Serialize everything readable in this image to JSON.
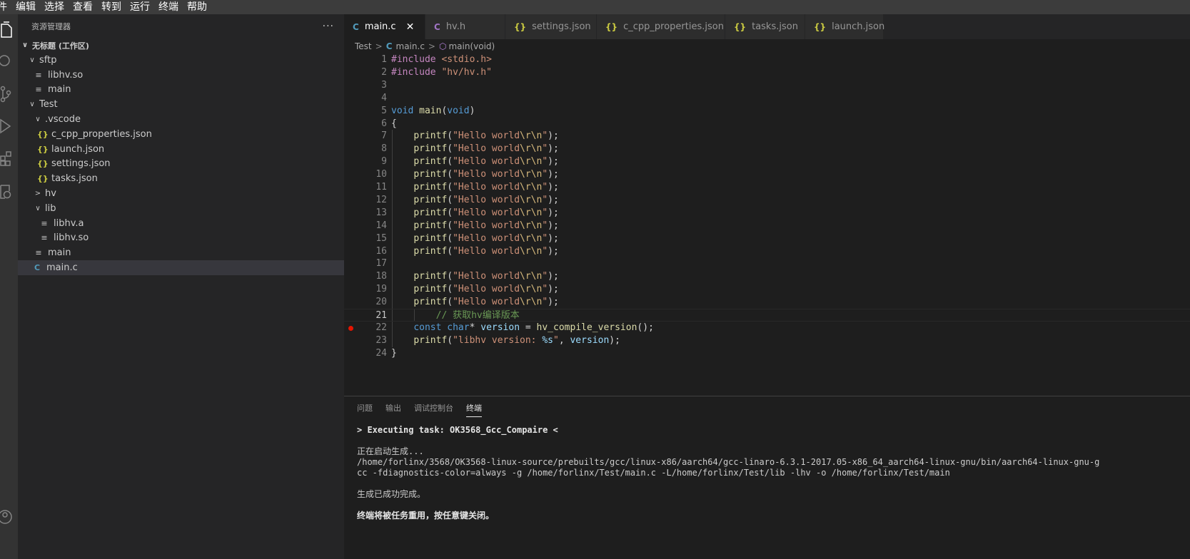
{
  "menu": [
    "件",
    "编辑",
    "选择",
    "查看",
    "转到",
    "运行",
    "终端",
    "帮助"
  ],
  "activity_icons": [
    "explorer-icon",
    "search-icon",
    "source-control-icon",
    "run-debug-icon",
    "extensions-icon",
    "remote-explorer-icon",
    "account-icon"
  ],
  "sidebar": {
    "title": "资源管理器",
    "more": "···",
    "tree": [
      {
        "label": "无标题 (工作区)",
        "chev": "∨",
        "icon": "",
        "type": "workspace"
      },
      {
        "label": "sftp",
        "chev": "∨",
        "icon": "",
        "type": "folder"
      },
      {
        "label": "libhv.so",
        "chev": "",
        "icon": "≡",
        "type": "txt"
      },
      {
        "label": "main",
        "chev": "",
        "icon": "≡",
        "type": "txt"
      },
      {
        "label": "Test",
        "chev": "∨",
        "icon": "",
        "type": "folder"
      },
      {
        "label": ".vscode",
        "chev": "∨",
        "icon": "",
        "type": "folder"
      },
      {
        "label": "c_cpp_properties.json",
        "chev": "",
        "icon": "{}",
        "type": "json"
      },
      {
        "label": "launch.json",
        "chev": "",
        "icon": "{}",
        "type": "json"
      },
      {
        "label": "settings.json",
        "chev": "",
        "icon": "{}",
        "type": "json"
      },
      {
        "label": "tasks.json",
        "chev": "",
        "icon": "{}",
        "type": "json"
      },
      {
        "label": "hv",
        "chev": ">",
        "icon": "",
        "type": "folder"
      },
      {
        "label": "lib",
        "chev": "∨",
        "icon": "",
        "type": "folder"
      },
      {
        "label": "libhv.a",
        "chev": "",
        "icon": "≡",
        "type": "txt"
      },
      {
        "label": "libhv.so",
        "chev": "",
        "icon": "≡",
        "type": "txt"
      },
      {
        "label": "main",
        "chev": "",
        "icon": "≡",
        "type": "txt"
      },
      {
        "label": "main.c",
        "chev": "",
        "icon": "C",
        "type": "c",
        "selected": true
      }
    ]
  },
  "tabs": [
    {
      "label": "main.c",
      "icon": "C",
      "kind": "c",
      "active": true,
      "close": "✕"
    },
    {
      "label": "hv.h",
      "icon": "C",
      "kind": "h"
    },
    {
      "label": "settings.json",
      "icon": "{}",
      "kind": "json"
    },
    {
      "label": "c_cpp_properties.json",
      "icon": "{}",
      "kind": "json"
    },
    {
      "label": "tasks.json",
      "icon": "{}",
      "kind": "json"
    },
    {
      "label": "launch.json",
      "icon": "{}",
      "kind": "json"
    }
  ],
  "breadcrumb": {
    "folder": "Test",
    "sep": ">",
    "file_icon": "C",
    "file": "main.c",
    "symbol_icon": "⬡",
    "symbol": "main(void)"
  },
  "code": {
    "current_line": 21,
    "breakpoint_line": 22,
    "lines": [
      [
        {
          "t": "#include ",
          "c": "pre"
        },
        {
          "t": "<stdio.h>",
          "c": "inc"
        }
      ],
      [
        {
          "t": "#include ",
          "c": "pre"
        },
        {
          "t": "\"hv/hv.h\"",
          "c": "inc"
        }
      ],
      [],
      [],
      [
        {
          "t": "void ",
          "c": "kw"
        },
        {
          "t": "main",
          "c": "fn"
        },
        {
          "t": "(",
          "c": "p"
        },
        {
          "t": "void",
          "c": "kw"
        },
        {
          "t": ")",
          "c": "p"
        }
      ],
      [
        {
          "t": "{",
          "c": "p"
        }
      ],
      [
        {
          "t": "    ",
          "c": "p"
        },
        {
          "t": "printf",
          "c": "fn"
        },
        {
          "t": "(",
          "c": "p"
        },
        {
          "t": "\"Hello world",
          "c": "str"
        },
        {
          "t": "\\r\\n",
          "c": "esc"
        },
        {
          "t": "\"",
          "c": "str"
        },
        {
          "t": ");",
          "c": "p"
        }
      ],
      [
        {
          "t": "    ",
          "c": "p"
        },
        {
          "t": "printf",
          "c": "fn"
        },
        {
          "t": "(",
          "c": "p"
        },
        {
          "t": "\"Hello world",
          "c": "str"
        },
        {
          "t": "\\r\\n",
          "c": "esc"
        },
        {
          "t": "\"",
          "c": "str"
        },
        {
          "t": ");",
          "c": "p"
        }
      ],
      [
        {
          "t": "    ",
          "c": "p"
        },
        {
          "t": "printf",
          "c": "fn"
        },
        {
          "t": "(",
          "c": "p"
        },
        {
          "t": "\"Hello world",
          "c": "str"
        },
        {
          "t": "\\r\\n",
          "c": "esc"
        },
        {
          "t": "\"",
          "c": "str"
        },
        {
          "t": ");",
          "c": "p"
        }
      ],
      [
        {
          "t": "    ",
          "c": "p"
        },
        {
          "t": "printf",
          "c": "fn"
        },
        {
          "t": "(",
          "c": "p"
        },
        {
          "t": "\"Hello world",
          "c": "str"
        },
        {
          "t": "\\r\\n",
          "c": "esc"
        },
        {
          "t": "\"",
          "c": "str"
        },
        {
          "t": ");",
          "c": "p"
        }
      ],
      [
        {
          "t": "    ",
          "c": "p"
        },
        {
          "t": "printf",
          "c": "fn"
        },
        {
          "t": "(",
          "c": "p"
        },
        {
          "t": "\"Hello world",
          "c": "str"
        },
        {
          "t": "\\r\\n",
          "c": "esc"
        },
        {
          "t": "\"",
          "c": "str"
        },
        {
          "t": ");",
          "c": "p"
        }
      ],
      [
        {
          "t": "    ",
          "c": "p"
        },
        {
          "t": "printf",
          "c": "fn"
        },
        {
          "t": "(",
          "c": "p"
        },
        {
          "t": "\"Hello world",
          "c": "str"
        },
        {
          "t": "\\r\\n",
          "c": "esc"
        },
        {
          "t": "\"",
          "c": "str"
        },
        {
          "t": ");",
          "c": "p"
        }
      ],
      [
        {
          "t": "    ",
          "c": "p"
        },
        {
          "t": "printf",
          "c": "fn"
        },
        {
          "t": "(",
          "c": "p"
        },
        {
          "t": "\"Hello world",
          "c": "str"
        },
        {
          "t": "\\r\\n",
          "c": "esc"
        },
        {
          "t": "\"",
          "c": "str"
        },
        {
          "t": ");",
          "c": "p"
        }
      ],
      [
        {
          "t": "    ",
          "c": "p"
        },
        {
          "t": "printf",
          "c": "fn"
        },
        {
          "t": "(",
          "c": "p"
        },
        {
          "t": "\"Hello world",
          "c": "str"
        },
        {
          "t": "\\r\\n",
          "c": "esc"
        },
        {
          "t": "\"",
          "c": "str"
        },
        {
          "t": ");",
          "c": "p"
        }
      ],
      [
        {
          "t": "    ",
          "c": "p"
        },
        {
          "t": "printf",
          "c": "fn"
        },
        {
          "t": "(",
          "c": "p"
        },
        {
          "t": "\"Hello world",
          "c": "str"
        },
        {
          "t": "\\r\\n",
          "c": "esc"
        },
        {
          "t": "\"",
          "c": "str"
        },
        {
          "t": ");",
          "c": "p"
        }
      ],
      [
        {
          "t": "    ",
          "c": "p"
        },
        {
          "t": "printf",
          "c": "fn"
        },
        {
          "t": "(",
          "c": "p"
        },
        {
          "t": "\"Hello world",
          "c": "str"
        },
        {
          "t": "\\r\\n",
          "c": "esc"
        },
        {
          "t": "\"",
          "c": "str"
        },
        {
          "t": ");",
          "c": "p"
        }
      ],
      [],
      [
        {
          "t": "    ",
          "c": "p"
        },
        {
          "t": "printf",
          "c": "fn"
        },
        {
          "t": "(",
          "c": "p"
        },
        {
          "t": "\"Hello world",
          "c": "str"
        },
        {
          "t": "\\r\\n",
          "c": "esc"
        },
        {
          "t": "\"",
          "c": "str"
        },
        {
          "t": ");",
          "c": "p"
        }
      ],
      [
        {
          "t": "    ",
          "c": "p"
        },
        {
          "t": "printf",
          "c": "fn"
        },
        {
          "t": "(",
          "c": "p"
        },
        {
          "t": "\"Hello world",
          "c": "str"
        },
        {
          "t": "\\r\\n",
          "c": "esc"
        },
        {
          "t": "\"",
          "c": "str"
        },
        {
          "t": ");",
          "c": "p"
        }
      ],
      [
        {
          "t": "    ",
          "c": "p"
        },
        {
          "t": "printf",
          "c": "fn"
        },
        {
          "t": "(",
          "c": "p"
        },
        {
          "t": "\"Hello world",
          "c": "str"
        },
        {
          "t": "\\r\\n",
          "c": "esc"
        },
        {
          "t": "\"",
          "c": "str"
        },
        {
          "t": ");",
          "c": "p"
        }
      ],
      [
        {
          "t": "        ",
          "c": "p"
        },
        {
          "t": "// 获取hv编译版本",
          "c": "cm"
        }
      ],
      [
        {
          "t": "    ",
          "c": "p"
        },
        {
          "t": "const ",
          "c": "kw"
        },
        {
          "t": "char",
          "c": "kw"
        },
        {
          "t": "* ",
          "c": "p"
        },
        {
          "t": "version",
          "c": "var"
        },
        {
          "t": " = ",
          "c": "p"
        },
        {
          "t": "hv_compile_version",
          "c": "fn"
        },
        {
          "t": "();",
          "c": "p"
        }
      ],
      [
        {
          "t": "    ",
          "c": "p"
        },
        {
          "t": "printf",
          "c": "fn"
        },
        {
          "t": "(",
          "c": "p"
        },
        {
          "t": "\"libhv version: ",
          "c": "str"
        },
        {
          "t": "%s",
          "c": "var"
        },
        {
          "t": "\"",
          "c": "str"
        },
        {
          "t": ", ",
          "c": "p"
        },
        {
          "t": "version",
          "c": "var"
        },
        {
          "t": ");",
          "c": "p"
        }
      ],
      [
        {
          "t": "}",
          "c": "p"
        }
      ]
    ]
  },
  "panel": {
    "tabs": [
      {
        "label": "问题"
      },
      {
        "label": "输出"
      },
      {
        "label": "调试控制台"
      },
      {
        "label": "终端",
        "active": true
      }
    ],
    "terminal": [
      {
        "text": "> Executing task: OK3568_Gcc_Compaire <",
        "bold": true
      },
      {
        "text": ""
      },
      {
        "text": "正在启动生成..."
      },
      {
        "text": "/home/forlinx/3568/OK3568-linux-source/prebuilts/gcc/linux-x86/aarch64/gcc-linaro-6.3.1-2017.05-x86_64_aarch64-linux-gnu/bin/aarch64-linux-gnu-g"
      },
      {
        "text": "cc -fdiagnostics-color=always -g /home/forlinx/Test/main.c -L/home/forlinx/Test/lib -lhv -o /home/forlinx/Test/main"
      },
      {
        "text": ""
      },
      {
        "text": "生成已成功完成。"
      },
      {
        "text": ""
      },
      {
        "text": "终端将被任务重用，按任意键关闭。",
        "bold": true
      }
    ]
  }
}
